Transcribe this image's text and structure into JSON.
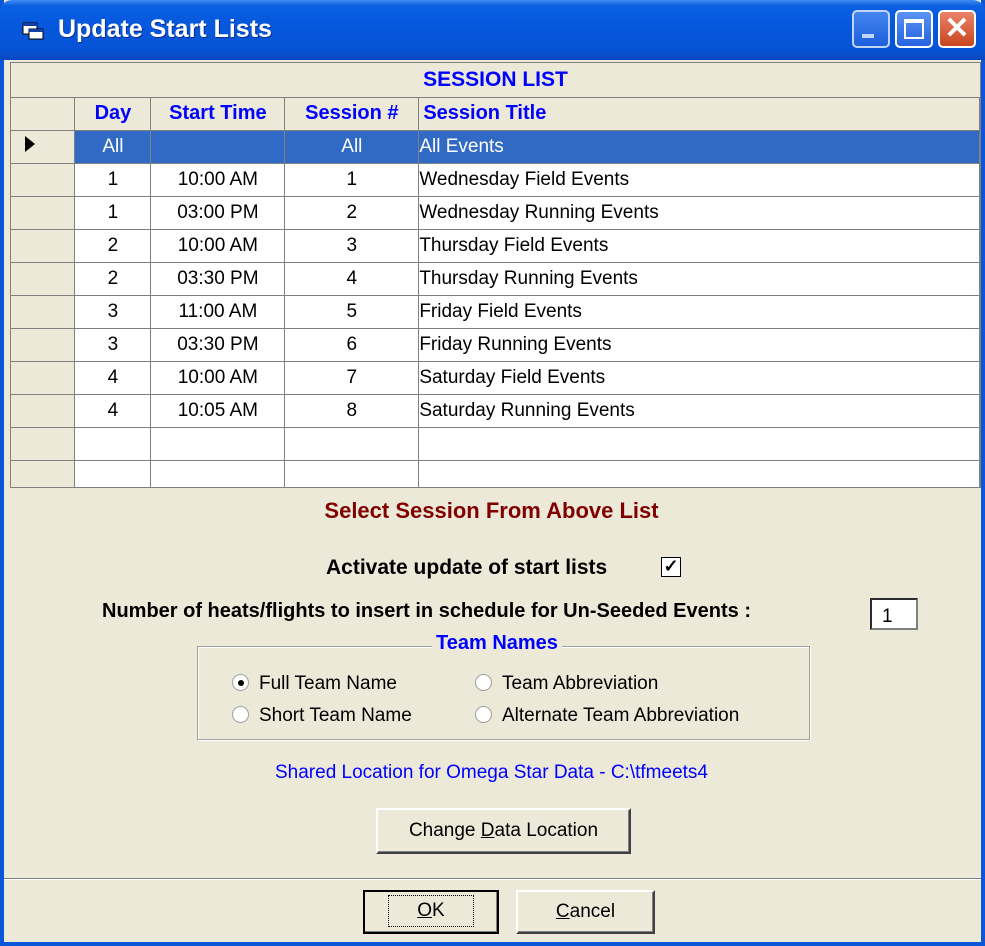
{
  "window": {
    "title": "Update Start Lists"
  },
  "grid": {
    "caption": "SESSION LIST",
    "columns": {
      "day": "Day",
      "start_time": "Start Time",
      "session": "Session #",
      "title": "Session Title"
    },
    "rows": [
      {
        "day": "All",
        "start_time": "",
        "session": "All",
        "title": "All Events",
        "selected": true
      },
      {
        "day": "1",
        "start_time": "10:00 AM",
        "session": "1",
        "title": "Wednesday Field Events"
      },
      {
        "day": "1",
        "start_time": "03:00 PM",
        "session": "2",
        "title": "Wednesday Running Events"
      },
      {
        "day": "2",
        "start_time": "10:00 AM",
        "session": "3",
        "title": "Thursday Field Events"
      },
      {
        "day": "2",
        "start_time": "03:30 PM",
        "session": "4",
        "title": "Thursday Running Events"
      },
      {
        "day": "3",
        "start_time": "11:00 AM",
        "session": "5",
        "title": "Friday Field Events"
      },
      {
        "day": "3",
        "start_time": "03:30 PM",
        "session": "6",
        "title": "Friday Running Events"
      },
      {
        "day": "4",
        "start_time": "10:00 AM",
        "session": "7",
        "title": "Saturday Field Events"
      },
      {
        "day": "4",
        "start_time": "10:05 AM",
        "session": "8",
        "title": "Saturday Running Events"
      },
      {
        "day": "",
        "start_time": "",
        "session": "",
        "title": ""
      },
      {
        "day": "",
        "start_time": "",
        "session": "",
        "title": ""
      }
    ]
  },
  "form": {
    "heading": "Select Session From Above List",
    "activate_label": "Activate update of start lists",
    "activate_checked": true,
    "heats_label": "Number of heats/flights to insert in schedule for Un-Seeded Events :",
    "heats_value": "1",
    "team_names": {
      "legend": "Team Names",
      "options": [
        {
          "label": "Full Team Name",
          "selected": true
        },
        {
          "label": "Team Abbreviation",
          "selected": false
        },
        {
          "label": "Short Team Name",
          "selected": false
        },
        {
          "label": "Alternate Team Abbreviation",
          "selected": false
        }
      ]
    },
    "shared_location": "Shared Location for Omega Star Data  -  C:\\tfmeets4",
    "change_location_button": {
      "prefix": "Change ",
      "accel": "D",
      "suffix": "ata Location"
    }
  },
  "buttons": {
    "ok": {
      "accel": "O",
      "suffix": "K"
    },
    "cancel": {
      "accel": "C",
      "suffix": "ancel"
    }
  },
  "colors": {
    "titlebar": "#0653D6",
    "selection": "#316AC5",
    "heading_text": "#800000",
    "link_blue": "#0000FF",
    "dialog_bg": "#ECE9D8"
  }
}
